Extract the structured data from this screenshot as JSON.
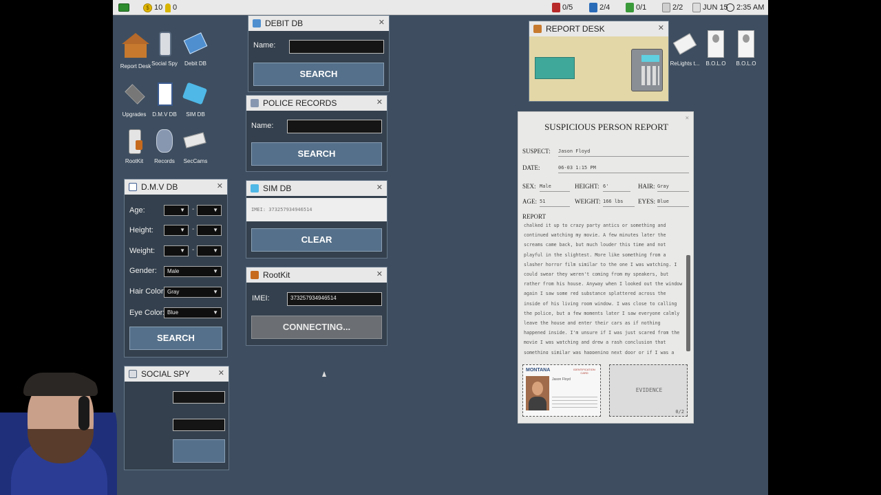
{
  "topbar": {
    "coins": "10",
    "keys": "0",
    "stat1": "0/5",
    "stat2": "2/4",
    "stat3": "0/1",
    "stat4": "2/2",
    "date": "JUN 15",
    "time": "2:35 AM"
  },
  "desktop_icons": [
    {
      "label": "Report Desk"
    },
    {
      "label": "Social Spy"
    },
    {
      "label": "Debit DB"
    },
    {
      "label": "Upgrades"
    },
    {
      "label": "D.M.V DB"
    },
    {
      "label": "SIM DB"
    },
    {
      "label": "RootKit"
    },
    {
      "label": "Records"
    },
    {
      "label": "SecCams"
    }
  ],
  "right_icons": [
    {
      "label": "ReLights t..."
    },
    {
      "label": "B.O.L.O"
    },
    {
      "label": "B.O.L.O"
    }
  ],
  "debit_db": {
    "title": "DEBIT DB",
    "name_label": "Name:",
    "name_value": "",
    "search_label": "SEARCH"
  },
  "police_records": {
    "title": "POLICE RECORDS",
    "name_label": "Name:",
    "name_value": "",
    "search_label": "SEARCH"
  },
  "sim_db": {
    "title": "SIM DB",
    "imei_text": "IMEI: 373257934946514",
    "clear_label": "CLEAR"
  },
  "rootkit": {
    "title": "RootKit",
    "imei_label": "IMEI:",
    "imei_value": "373257934946514",
    "connect_label": "CONNECTING..."
  },
  "dmv_db": {
    "title": "D.M.V DB",
    "age_label": "Age:",
    "height_label": "Height:",
    "weight_label": "Weight:",
    "gender_label": "Gender:",
    "gender_value": "Male",
    "hair_label": "Hair Color:",
    "hair_value": "Gray",
    "eye_label": "Eye Color:",
    "eye_value": "Blue",
    "range_sep": "-",
    "search_label": "SEARCH"
  },
  "social_spy": {
    "title": "SOCIAL SPY"
  },
  "report_desk": {
    "title": "REPORT DESK"
  },
  "report": {
    "title": "SUSPICIOUS PERSON REPORT",
    "suspect_label": "SUSPECT:",
    "suspect_value": "Jason Floyd",
    "date_label": "DATE:",
    "date_value": "06-03 1:15 PM",
    "sex_label": "SEX:",
    "sex_value": "Male",
    "height_label": "HEIGHT:",
    "height_value": "6'",
    "hair_label": "HAIR:",
    "hair_value": "Gray",
    "age_label": "AGE:",
    "age_value": "51",
    "weight_label": "WEIGHT:",
    "weight_value": "166 lbs",
    "eyes_label": "EYES:",
    "eyes_value": "Blue",
    "report_label": "REPORT",
    "body": "chalked it up to crazy party antics or something and continued watching my movie. A few minutes later the screams came back, but much louder this time and not playful in the slightest. More like something from a slasher horror film similar to the one I was watching. I could swear they weren't coming from my speakers, but rather from his house. Anyway when I looked out the window again I saw some red substance splattered across the inside of his living room window. I was close to calling the police, but a few moments later I saw everyone calmly leave the house and enter their cars as if nothing happened inside. I'm unsure if I was just scared from the movie I was watching and drew a rash conclusion that something similar was happening next door or if I was a",
    "id_state": "MONTANA",
    "id_type": "IDENTIFICATION CARD",
    "id_name": "Jason Floyd",
    "evidence_label": "EVIDENCE",
    "evidence_count": "0/2"
  },
  "colors": {
    "desktop": "#3e4e60",
    "button": "#55708a",
    "window": "#34404d"
  }
}
